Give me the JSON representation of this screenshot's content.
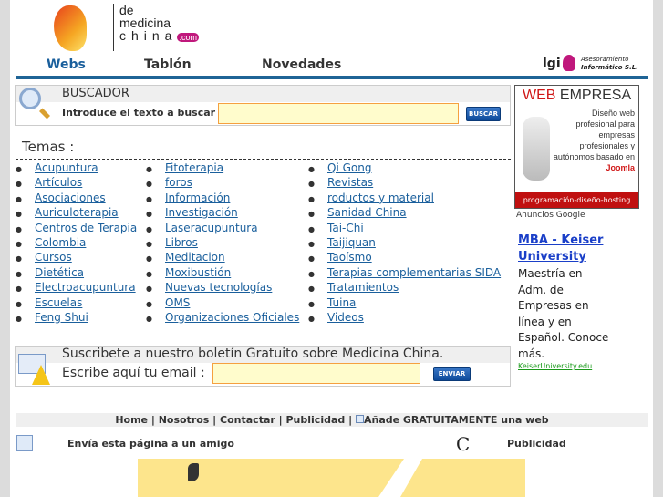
{
  "logo": {
    "line1": "de",
    "line2": "medicina",
    "line3": "china",
    "tld": ".com"
  },
  "nav": {
    "items": [
      "Webs",
      "Tablón",
      "Novedades"
    ]
  },
  "partner": {
    "name": "lgi",
    "tagline1": "Asesoramiento",
    "tagline2": "Informático S.L."
  },
  "search": {
    "title": "BUSCADOR",
    "label": "Introduce el texto a buscar :",
    "value": "",
    "button": "BUSCAR"
  },
  "topics": {
    "title": "Temas :",
    "col1": [
      "Acupuntura",
      "Artículos",
      "Asociaciones",
      "Auriculoterapia",
      "Centros de Terapia",
      "Colombia",
      "Cursos",
      "Dietética",
      "Electroacupuntura",
      "Escuelas",
      "Feng Shui"
    ],
    "col2": [
      "Fitoterapia",
      "foros",
      "Información",
      "Investigación",
      "Laseracupuntura",
      "Libros",
      "Meditacion",
      "Moxibustión",
      "Nuevas tecnologías",
      "OMS",
      "Organizaciones Oficiales"
    ],
    "col3": [
      "Qi Gong",
      "Revistas",
      "roductos y material",
      "Sanidad China",
      "Tai-Chi",
      "Taijiquan",
      "Taoísmo",
      "Terapias complementarias SIDA",
      "Tratamientos",
      "Tuina",
      "Videos"
    ]
  },
  "newsletter": {
    "title": "Suscribete a nuestro boletín Gratuito sobre Medicina China.",
    "label": "Escribe aquí tu email :",
    "value": "",
    "button": "ENVIAR"
  },
  "ad": {
    "brand_red": "WEB",
    "brand_dark": "EMPRESA",
    "body": "Diseño web profesional para empresas profesionales y autónomos basado en",
    "joomla": "Joomla",
    "footer": "programación-diseño-hosting",
    "google": "Anuncios Google"
  },
  "textad": {
    "title": "MBA - Keiser University",
    "body": "Maestría en Adm. de Empresas en línea y en Español. Conoce más.",
    "url": "KeiserUniversity.edu"
  },
  "footer": {
    "links": [
      "Home",
      "Nosotros",
      "Contactar",
      "Publicidad",
      "Añade GRATUITAMENTE una web"
    ],
    "send": "Envía esta página a un amigo",
    "publicidad": "Publicidad"
  }
}
